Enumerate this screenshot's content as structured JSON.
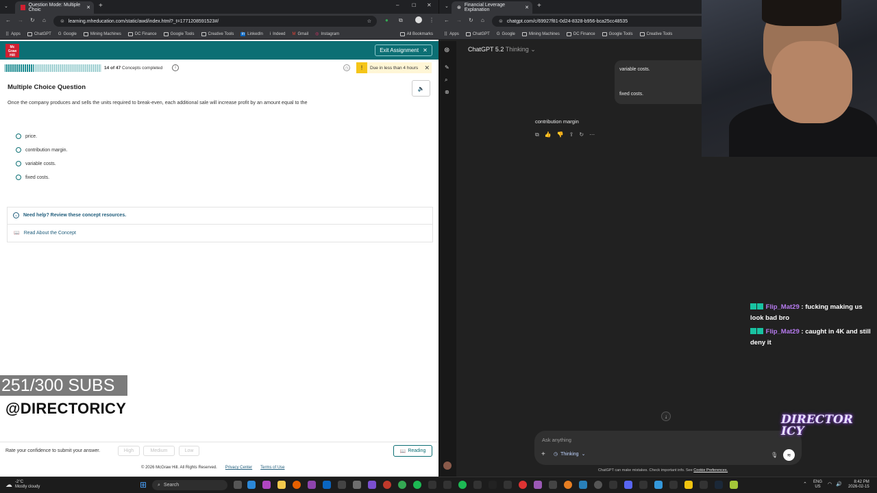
{
  "left_browser": {
    "tab_title": "Question Mode: Multiple Choic",
    "url": "learning.mheducation.com/static/awd/index.html?_t=1771208591523#/",
    "bookmarks": [
      "Apps",
      "ChatGPT",
      "Google",
      "Mining Machines",
      "DC Finance",
      "Google Tools",
      "Creative Tools",
      "LinkedIn",
      "Indeed",
      "Gmail",
      "Instagram"
    ],
    "all_bookmarks": "All Bookmarks"
  },
  "assignment": {
    "logo": "Mc Graw Hill",
    "exit_label": "Exit Assignment",
    "progress_done": 14,
    "progress_total": 47,
    "progress_fraction": 0.3,
    "progress_text": "14 of 47",
    "progress_suffix": "Concepts completed",
    "due_text": "Due in less than 4 hours"
  },
  "question": {
    "type_title": "Multiple Choice Question",
    "text": "Once the company produces and sells the units required to break-even, each additional sale will increase profit by an amount equal to the",
    "options": [
      "price.",
      "contribution margin.",
      "variable costs.",
      "fixed costs."
    ]
  },
  "help": {
    "title": "Need help? Review these concept resources.",
    "link": "Read About the Concept"
  },
  "overlay": {
    "subs": "251/300 SUBS",
    "handle": "@DIRECTORICY"
  },
  "footer": {
    "confidence_prompt": "Rate your confidence to submit your answer.",
    "high": "High",
    "medium": "Medium",
    "low": "Low",
    "reading": "Reading",
    "copyright": "© 2026 McGraw Hill. All Rights Reserved.",
    "privacy": "Privacy Center",
    "terms": "Terms of Use"
  },
  "right_browser": {
    "tab_title": "Financial Leverage Explanation",
    "url": "chatgpt.com/c/69927f81-0d24-8328-b956-bca25cc48535",
    "bookmarks": [
      "Apps",
      "ChatGPT",
      "Google",
      "Mining Machines",
      "DC Finance",
      "Google Tools",
      "Creative Tools"
    ]
  },
  "chatgpt": {
    "model": "ChatGPT 5.2",
    "mode": "Thinking",
    "user_bubble_1": "variable costs.",
    "user_bubble_2": "fixed costs.",
    "answer": "contribution margin",
    "placeholder": "Ask anything",
    "thinking_label": "Thinking",
    "disclaimer": "ChatGPT can make mistakes. Check important info. See",
    "cookie": "Cookie Preferences."
  },
  "stream_chat": [
    {
      "user": "Flip_Mat29",
      "message": ": fucking making us look bad bro"
    },
    {
      "user": "Flip_Mat29",
      "message": ": caught in 4K and still deny it"
    }
  ],
  "stream_logo": "DIRECTOR ICY",
  "taskbar": {
    "weather_temp": "-2°C",
    "weather_desc": "Mostly cloudy",
    "search": "Search",
    "lang": "ENG",
    "region": "US",
    "time": "8:42 PM",
    "date": "2026-02-15"
  },
  "colors": {
    "mh_teal": "#0c6f74",
    "mh_red": "#d12031",
    "chat_user": "#b77bf0",
    "gpt_bg": "#212121"
  }
}
